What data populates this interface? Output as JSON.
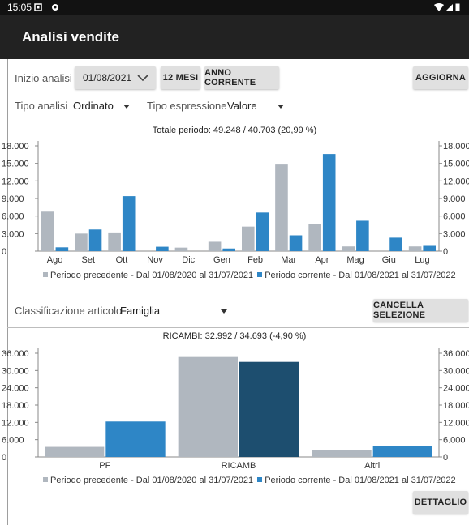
{
  "status": {
    "time": "15:05"
  },
  "app": {
    "title": "Analisi vendite"
  },
  "controls": {
    "inizio_label": "Inizio analisi",
    "date_value": "01/08/2021",
    "btn_12mesi": "12 MESI",
    "btn_anno": "ANNO CORRENTE",
    "btn_aggiorna": "AGGIORNA",
    "tipo_analisi_label": "Tipo analisi",
    "tipo_analisi_value": "Ordinato",
    "tipo_espr_label": "Tipo espressione",
    "tipo_espr_value": "Valore",
    "classif_label": "Classificazione articolo",
    "classif_value": "Famiglia",
    "btn_cancella": "CANCELLA SELEZIONE",
    "btn_dettaglio": "DETTAGLIO"
  },
  "colors": {
    "prev": "#b0b7bf",
    "curr": "#2e86c6",
    "curr_selected": "#1d4e6f"
  },
  "chart_data": [
    {
      "type": "bar",
      "title": "Totale periodo: 49.248 / 40.703 (20,99 %)",
      "categories": [
        "Ago",
        "Set",
        "Ott",
        "Nov",
        "Dic",
        "Gen",
        "Feb",
        "Mar",
        "Apr",
        "Mag",
        "Giu",
        "Lug"
      ],
      "series": [
        {
          "name": "Periodo precedente - Dal 01/08/2020 al 31/07/2021",
          "values": [
            6750,
            3000,
            3200,
            0,
            600,
            1600,
            4200,
            14800,
            4600,
            800,
            0,
            800
          ]
        },
        {
          "name": "Periodo corrente - Dal 01/08/2021 al 31/07/2022",
          "values": [
            650,
            3700,
            9400,
            750,
            0,
            450,
            6600,
            2700,
            16600,
            5200,
            2300,
            900
          ]
        }
      ],
      "yticks": [
        "0",
        "3.000",
        "6.000",
        "9.000",
        "12.000",
        "15.000",
        "18.000"
      ],
      "ylim": [
        0,
        18000
      ],
      "legend": [
        "Periodo precedente - Dal 01/08/2020 al 31/07/2021",
        "Periodo corrente - Dal 01/08/2021 al 31/07/2022"
      ]
    },
    {
      "type": "bar",
      "title": "RICAMBI: 32.992 / 34.693 (-4,90 %)",
      "categories": [
        "PF",
        "RICAMB",
        "Altri"
      ],
      "series": [
        {
          "name": "Periodo precedente - Dal 01/08/2020 al 31/07/2021",
          "values": [
            3500,
            34693,
            2300
          ]
        },
        {
          "name": "Periodo corrente - Dal 01/08/2021 al 31/07/2022",
          "values": [
            12300,
            32992,
            3900
          ]
        }
      ],
      "yticks": [
        "0",
        "6.000",
        "12.000",
        "18.000",
        "24.000",
        "30.000",
        "36.000"
      ],
      "ylim": [
        0,
        36000
      ],
      "legend": [
        "Periodo precedente - Dal 01/08/2020 al 31/07/2021",
        "Periodo corrente - Dal 01/08/2021 al 31/07/2022"
      ]
    }
  ]
}
